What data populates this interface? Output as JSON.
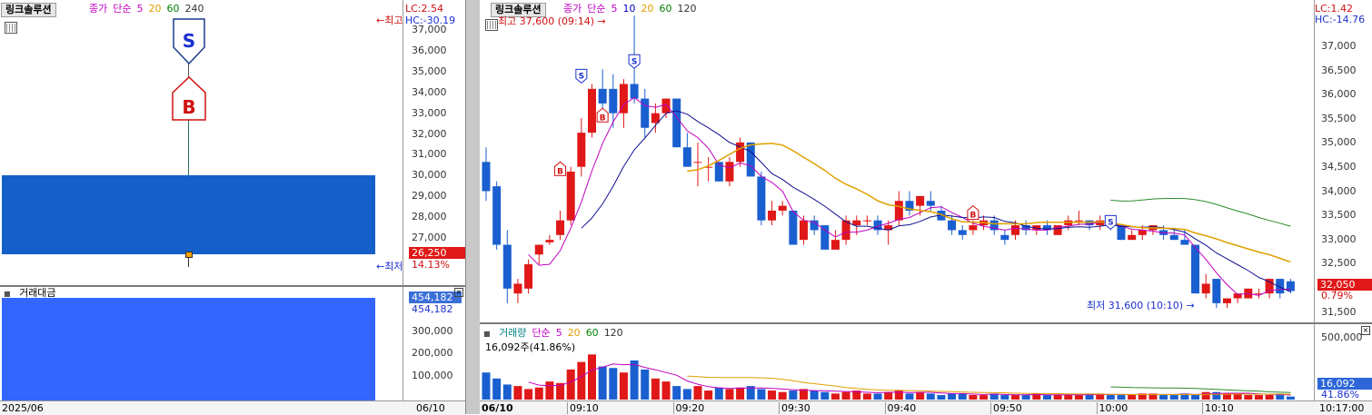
{
  "left_chart": {
    "title": "링크솔루션",
    "legend": [
      "종가",
      "단순",
      "5",
      "20",
      "60",
      "240"
    ],
    "legend_colors": [
      "#c000c0",
      "#c000c0",
      "#c000c0",
      "#e0a000",
      "#008000",
      "#333333"
    ],
    "lc": "LC:2.54",
    "hc": "HC:-30.19",
    "arrow_high": "최고",
    "arrow_low": "최저",
    "price_badge": "26,250",
    "change_pct": "14.13%",
    "yticks": [
      "37,000",
      "36,000",
      "35,000",
      "34,000",
      "33,000",
      "32,000",
      "31,000",
      "30,000",
      "29,000",
      "28,000",
      "27,000"
    ],
    "sell_marker": "S",
    "buy_marker": "B"
  },
  "left_volume": {
    "title": "거래대금",
    "badge": "454,182",
    "value_label": "454,182",
    "yticks": [
      "300,000",
      "200,000",
      "100,000"
    ]
  },
  "left_footer": {
    "date": "2025/06",
    "right": "06/10"
  },
  "right_chart": {
    "title": "링크솔루션",
    "legend": [
      "종가",
      "단순",
      "5",
      "10",
      "20",
      "60",
      "120"
    ],
    "legend_colors": [
      "#c000c0",
      "#c000c0",
      "#c000c0",
      "#0000c0",
      "#e0a000",
      "#008000",
      "#333333"
    ],
    "lc": "LC:1.42",
    "hc": "HC:-14.76",
    "high_label": "최고 37,600 (09:14)",
    "low_label": "최저 31,600 (10:10)",
    "price_badge": "32,050",
    "change_pct": "0.79%",
    "yticks": [
      "37,000",
      "36,500",
      "36,000",
      "35,500",
      "35,000",
      "34,500",
      "34,000",
      "33,500",
      "33,000",
      "32,500",
      "32,000",
      "31,500"
    ]
  },
  "right_volume": {
    "legend": [
      "거래량",
      "단순",
      "5",
      "20",
      "60",
      "120"
    ],
    "legend_colors": [
      "#008080",
      "#c000c0",
      "#c000c0",
      "#e0a000",
      "#008000",
      "#333333"
    ],
    "sub_label": "16,092주(41.86%)",
    "badge": "16,092",
    "badge_pct": "41.86%",
    "yticks": [
      "500,000"
    ]
  },
  "right_footer": {
    "date": "06/10",
    "times": [
      "09:10",
      "09:20",
      "09:30",
      "09:40",
      "09:50",
      "10:00",
      "10:10"
    ],
    "clock": "10:17:00"
  },
  "chart_data": {
    "type": "candlestick",
    "interval": "1 minute",
    "x_start": "09:00",
    "y_range": [
      31400,
      37700
    ],
    "candles": [
      {
        "o": 34600,
        "h": 34900,
        "l": 33800,
        "c": 34000
      },
      {
        "o": 34100,
        "h": 34200,
        "l": 32800,
        "c": 32900
      },
      {
        "o": 32900,
        "h": 33200,
        "l": 31700,
        "c": 32000
      },
      {
        "o": 31900,
        "h": 32200,
        "l": 31700,
        "c": 32100
      },
      {
        "o": 32000,
        "h": 32600,
        "l": 31900,
        "c": 32500
      },
      {
        "o": 32700,
        "h": 32900,
        "l": 32500,
        "c": 32900
      },
      {
        "o": 32950,
        "h": 33100,
        "l": 32900,
        "c": 33000
      },
      {
        "o": 33100,
        "h": 33600,
        "l": 33000,
        "c": 33400
      },
      {
        "o": 33400,
        "h": 34500,
        "l": 33300,
        "c": 34400
      },
      {
        "o": 34500,
        "h": 35500,
        "l": 34300,
        "c": 35200
      },
      {
        "o": 35200,
        "h": 36200,
        "l": 35100,
        "c": 36100
      },
      {
        "o": 36100,
        "h": 36500,
        "l": 35600,
        "c": 35800
      },
      {
        "o": 36100,
        "h": 36400,
        "l": 35300,
        "c": 35600
      },
      {
        "o": 35600,
        "h": 36300,
        "l": 35300,
        "c": 36200
      },
      {
        "o": 36200,
        "h": 37600,
        "l": 35800,
        "c": 35900
      },
      {
        "o": 35900,
        "h": 36100,
        "l": 35100,
        "c": 35300
      },
      {
        "o": 35400,
        "h": 35800,
        "l": 35200,
        "c": 35600
      },
      {
        "o": 35600,
        "h": 35900,
        "l": 35500,
        "c": 35900
      },
      {
        "o": 35900,
        "h": 35900,
        "l": 34900,
        "c": 34900
      },
      {
        "o": 34900,
        "h": 35200,
        "l": 34500,
        "c": 34500
      },
      {
        "o": 34600,
        "h": 35000,
        "l": 34100,
        "c": 34600
      },
      {
        "o": 34500,
        "h": 34700,
        "l": 34200,
        "c": 34500
      },
      {
        "o": 34600,
        "h": 34600,
        "l": 34200,
        "c": 34200
      },
      {
        "o": 34200,
        "h": 34700,
        "l": 34100,
        "c": 34600
      },
      {
        "o": 34600,
        "h": 35100,
        "l": 34500,
        "c": 35000
      },
      {
        "o": 35000,
        "h": 35000,
        "l": 34300,
        "c": 34300
      },
      {
        "o": 34300,
        "h": 34400,
        "l": 33300,
        "c": 33400
      },
      {
        "o": 33400,
        "h": 33800,
        "l": 33300,
        "c": 33600
      },
      {
        "o": 33600,
        "h": 33800,
        "l": 33500,
        "c": 33700
      },
      {
        "o": 33600,
        "h": 33600,
        "l": 32900,
        "c": 32900
      },
      {
        "o": 33000,
        "h": 33500,
        "l": 32900,
        "c": 33400
      },
      {
        "o": 33400,
        "h": 33500,
        "l": 33100,
        "c": 33200
      },
      {
        "o": 33300,
        "h": 33300,
        "l": 32800,
        "c": 32800
      },
      {
        "o": 32800,
        "h": 33200,
        "l": 32800,
        "c": 33000
      },
      {
        "o": 33000,
        "h": 33500,
        "l": 32900,
        "c": 33400
      },
      {
        "o": 33300,
        "h": 33500,
        "l": 33100,
        "c": 33400
      },
      {
        "o": 33400,
        "h": 33500,
        "l": 33300,
        "c": 33400
      },
      {
        "o": 33400,
        "h": 33500,
        "l": 33100,
        "c": 33200
      },
      {
        "o": 33200,
        "h": 33400,
        "l": 32900,
        "c": 33300
      },
      {
        "o": 33400,
        "h": 34000,
        "l": 33300,
        "c": 33800
      },
      {
        "o": 33800,
        "h": 34000,
        "l": 33500,
        "c": 33600
      },
      {
        "o": 33700,
        "h": 33900,
        "l": 33500,
        "c": 33900
      },
      {
        "o": 33800,
        "h": 34000,
        "l": 33600,
        "c": 33700
      },
      {
        "o": 33600,
        "h": 33700,
        "l": 33400,
        "c": 33400
      },
      {
        "o": 33400,
        "h": 33500,
        "l": 33100,
        "c": 33200
      },
      {
        "o": 33200,
        "h": 33300,
        "l": 33000,
        "c": 33100
      },
      {
        "o": 33200,
        "h": 33400,
        "l": 33100,
        "c": 33300
      },
      {
        "o": 33300,
        "h": 33500,
        "l": 33200,
        "c": 33400
      },
      {
        "o": 33400,
        "h": 33500,
        "l": 33100,
        "c": 33200
      },
      {
        "o": 33100,
        "h": 33200,
        "l": 32900,
        "c": 33000
      },
      {
        "o": 33100,
        "h": 33400,
        "l": 33000,
        "c": 33300
      },
      {
        "o": 33300,
        "h": 33400,
        "l": 33100,
        "c": 33200
      },
      {
        "o": 33200,
        "h": 33300,
        "l": 33100,
        "c": 33300
      },
      {
        "o": 33300,
        "h": 33400,
        "l": 33100,
        "c": 33200
      },
      {
        "o": 33100,
        "h": 33300,
        "l": 33100,
        "c": 33300
      },
      {
        "o": 33300,
        "h": 33500,
        "l": 33200,
        "c": 33400
      },
      {
        "o": 33400,
        "h": 33600,
        "l": 33300,
        "c": 33400
      },
      {
        "o": 33400,
        "h": 33400,
        "l": 33200,
        "c": 33300
      },
      {
        "o": 33300,
        "h": 33500,
        "l": 33200,
        "c": 33400
      },
      {
        "o": 33400,
        "h": 33400,
        "l": 33200,
        "c": 33300
      },
      {
        "o": 33300,
        "h": 33300,
        "l": 33000,
        "c": 33000
      },
      {
        "o": 33000,
        "h": 33200,
        "l": 33000,
        "c": 33100
      },
      {
        "o": 33100,
        "h": 33300,
        "l": 33000,
        "c": 33200
      },
      {
        "o": 33200,
        "h": 33300,
        "l": 33100,
        "c": 33300
      },
      {
        "o": 33200,
        "h": 33300,
        "l": 33000,
        "c": 33100
      },
      {
        "o": 33100,
        "h": 33200,
        "l": 33000,
        "c": 33000
      },
      {
        "o": 33000,
        "h": 33200,
        "l": 32900,
        "c": 32900
      },
      {
        "o": 32900,
        "h": 32900,
        "l": 31900,
        "c": 31900
      },
      {
        "o": 31900,
        "h": 32300,
        "l": 31800,
        "c": 32100
      },
      {
        "o": 32200,
        "h": 32200,
        "l": 31600,
        "c": 31700
      },
      {
        "o": 31700,
        "h": 31800,
        "l": 31600,
        "c": 31800
      },
      {
        "o": 31800,
        "h": 31900,
        "l": 31700,
        "c": 31900
      },
      {
        "o": 31800,
        "h": 32000,
        "l": 31800,
        "c": 32000
      },
      {
        "o": 31900,
        "h": 32000,
        "l": 31800,
        "c": 31900
      },
      {
        "o": 31900,
        "h": 32200,
        "l": 31800,
        "c": 32200
      },
      {
        "o": 32200,
        "h": 32200,
        "l": 31800,
        "c": 31900
      },
      {
        "o": 32150,
        "h": 32200,
        "l": 31900,
        "c": 31950
      }
    ],
    "volume": [
      180,
      140,
      100,
      90,
      70,
      80,
      120,
      110,
      200,
      250,
      300,
      220,
      210,
      180,
      260,
      200,
      140,
      120,
      90,
      70,
      90,
      60,
      80,
      70,
      80,
      90,
      70,
      60,
      50,
      60,
      70,
      60,
      50,
      40,
      50,
      60,
      40,
      40,
      50,
      60,
      40,
      50,
      40,
      30,
      40,
      40,
      30,
      30,
      40,
      30,
      30,
      30,
      40,
      30,
      30,
      30,
      30,
      40,
      40,
      30,
      30,
      30,
      40,
      40,
      30,
      30,
      40,
      30,
      50,
      50,
      40,
      40,
      30,
      30,
      30,
      40,
      20
    ]
  }
}
